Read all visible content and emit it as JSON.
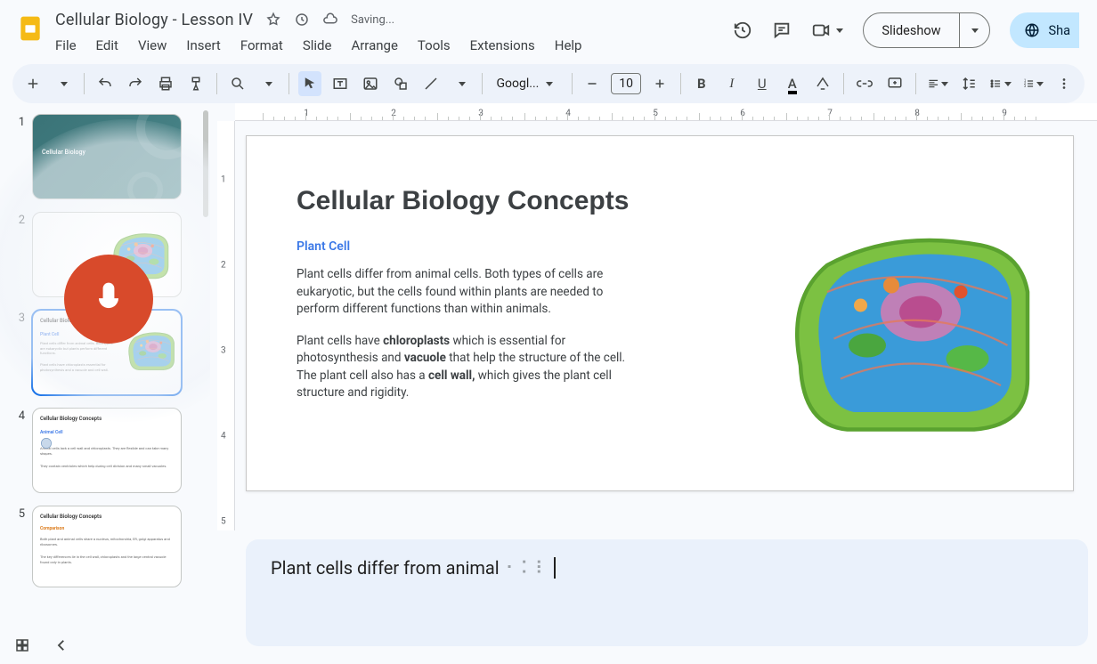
{
  "doc": {
    "title": "Cellular Biology - Lesson IV",
    "saving": "Saving..."
  },
  "menus": {
    "file": "File",
    "edit": "Edit",
    "view": "View",
    "insert": "Insert",
    "format": "Format",
    "slide": "Slide",
    "arrange": "Arrange",
    "tools": "Tools",
    "extensions": "Extensions",
    "help": "Help"
  },
  "header": {
    "slideshow": "Slideshow",
    "share": "Sha"
  },
  "toolbar": {
    "font_name": "Googl...",
    "font_size": "10"
  },
  "ruler_h": [
    "1",
    "2",
    "3",
    "4",
    "5",
    "6",
    "7",
    "8",
    "9"
  ],
  "ruler_v": [
    "1",
    "2",
    "3",
    "4",
    "5"
  ],
  "thumbs": {
    "n1": "1",
    "n2": "2",
    "n3": "3",
    "n4": "4",
    "n5": "5",
    "t1_title": "Cellular Biology",
    "t3_heading": "Cellular Biology Concepts",
    "t3_sub": "Plant Cell",
    "t4_heading": "Cellular Biology Concepts",
    "t5_heading": "Cellular Biology Concepts"
  },
  "slide": {
    "title": "Cellular Biology Concepts",
    "subtitle": "Plant Cell",
    "p1": "Plant cells differ from animal cells. Both types of cells are eukaryotic, but the cells found within plants are needed to perform different functions than within animals.",
    "p2a": "Plant cells have ",
    "p2b": "chloroplasts",
    "p2c": " which is essential for photosynthesis and ",
    "p2d": "vacuole",
    "p2e": " that help the structure of the cell. The plant cell also has a ",
    "p2f": "cell wall,",
    "p2g": " which gives the plant cell structure and rigidity."
  },
  "notes": {
    "text": "Plant cells differ from animal"
  }
}
